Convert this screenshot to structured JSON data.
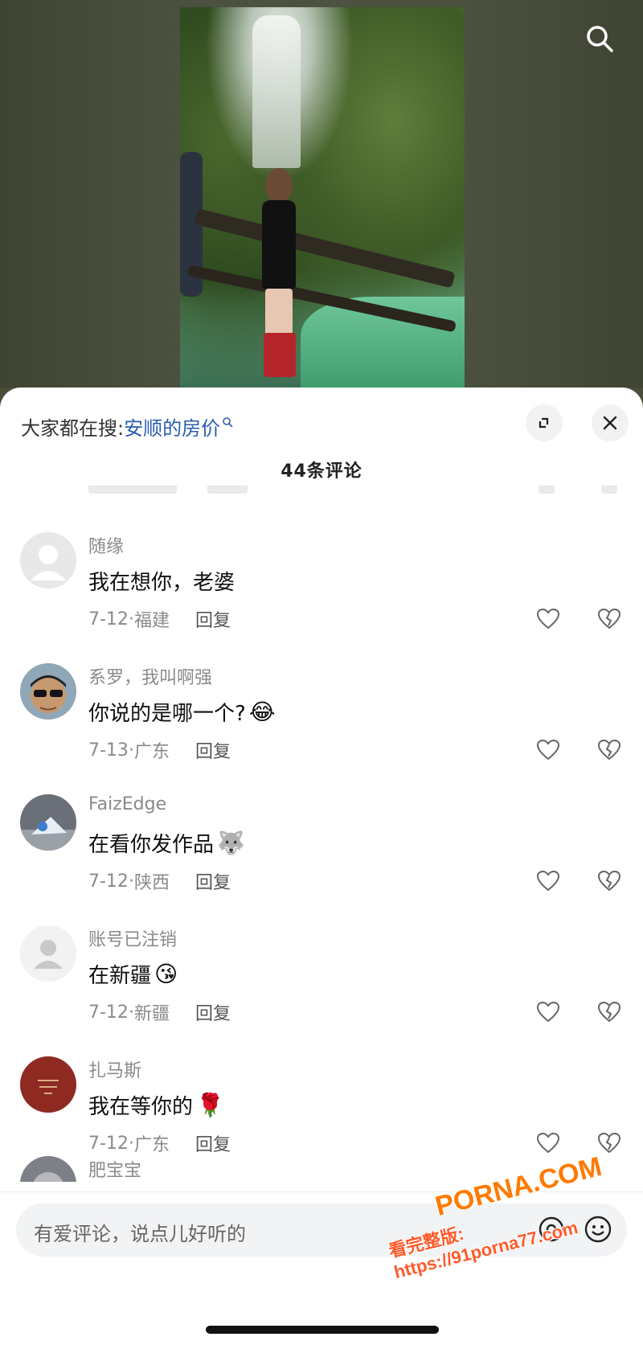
{
  "trend": {
    "prefix": "大家都在搜:",
    "keyword": "安顺的房价"
  },
  "comment_count_label": "44条评论",
  "comments": [
    {
      "username": "随缘",
      "text": "我在想你，老婆",
      "emoji": "",
      "date": "7-12",
      "location": "福建",
      "reply": "回复",
      "avatar": "default-avatar"
    },
    {
      "username": "系罗，我叫啊强",
      "text": "你说的是哪一个?",
      "emoji": "😂",
      "date": "7-13",
      "location": "广东",
      "reply": "回复",
      "avatar": "photo-avatar-sunglasses"
    },
    {
      "username": "FaizEdge",
      "text": "在看你发作品",
      "emoji": "🐺",
      "date": "7-12",
      "location": "陕西",
      "reply": "回复",
      "avatar": "photo-avatar-object"
    },
    {
      "username": "账号已注销",
      "text": "在新疆",
      "emoji": "😘",
      "date": "7-12",
      "location": "新疆",
      "reply": "回复",
      "avatar": "default-avatar"
    },
    {
      "username": "扎马斯",
      "text": "我在等你的",
      "emoji": "🌹",
      "date": "7-12",
      "location": "广东",
      "reply": "回复",
      "avatar": "red-badge-avatar"
    }
  ],
  "partial_comment": {
    "username": "肥宝宝"
  },
  "input": {
    "placeholder": "有爱评论，说点儿好听的"
  },
  "watermark": {
    "brand": "PORNA.COM",
    "line": "看完整版: https://91porna77.com"
  },
  "colors": {
    "keyword": "#2a5db0",
    "meta": "#8a8a8a",
    "watermark": "#ff7a00"
  }
}
